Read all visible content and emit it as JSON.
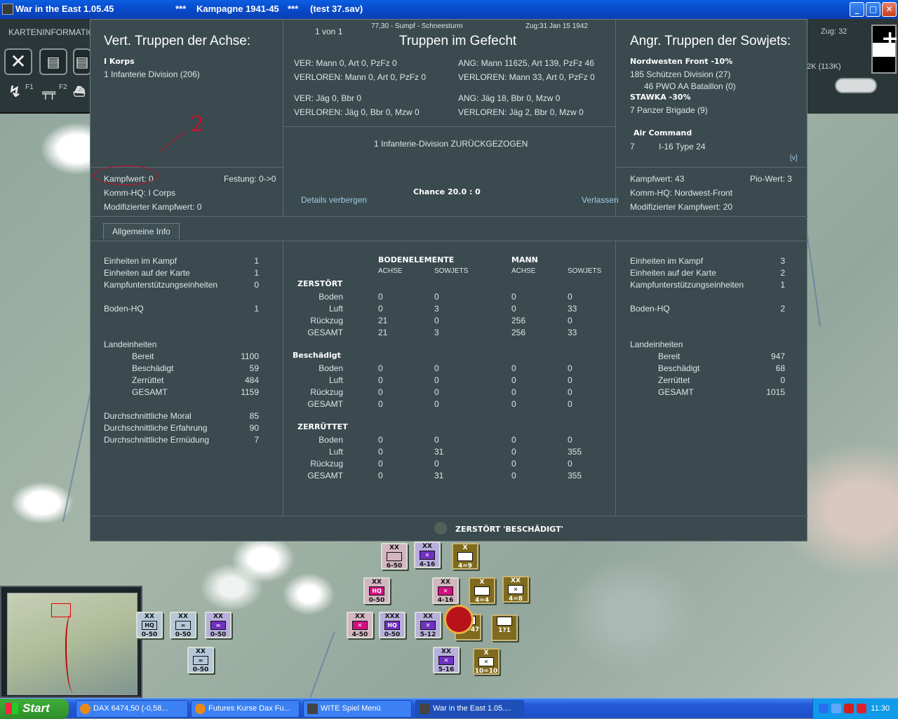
{
  "window": {
    "title_app": "War in the East 1.05.45",
    "title_stars1": "***",
    "title_campaign": "Kampagne 1941-45",
    "title_stars2": "***",
    "title_save": "(test 37.sav)",
    "btn_min": "_",
    "btn_max": "▢",
    "btn_close": "✕"
  },
  "control_panel": {
    "label": "KARTENINFORMATION",
    "f1": "F1",
    "f2": "F2"
  },
  "right_panel": {
    "turn": "Zug: 32",
    "k": "2K (113K)"
  },
  "dialog": {
    "left": {
      "title": "Vert. Truppen der Achse:",
      "corps": "I Korps",
      "division": "1 Infanterie Division (206)",
      "kampfwert": "Kampfwert: 0",
      "festung": "Festung: 0->0",
      "kommhq": "Komm-HQ: I Corps",
      "modkampfwert": "Modifizierter Kampfwert: 0"
    },
    "center": {
      "counter": "1 von 1",
      "info": "77,30 - Sumpf - Schneesturm",
      "turn_date": "Zug:31  Jan 15 1942",
      "title": "Truppen im Gefecht",
      "ver1": "VER: Mann 0, Art 0, PzFz 0",
      "verloren1": "VERLOREN: Mann 0, Art 0, PzFz 0",
      "ang1": "ANG: Mann 11625, Art 139, PzFz 46",
      "angverloren1": "VERLOREN: Mann 33, Art 0, PzFz 0",
      "ver2": "VER: Jäg 0, Bbr 0",
      "verloren2": "VERLOREN: Jäg 0, Bbr 0, Mzw 0",
      "ang2": "ANG: Jäg 18, Bbr 0, Mzw 0",
      "angverloren2": "VERLOREN: Jäg 2, Bbr 0, Mzw 0",
      "result": "1 Infanterie-Division ZURÜCKGEZOGEN",
      "chance": "Chance 20.0 : 0",
      "details": "Details verbergen",
      "leave": "Verlassen"
    },
    "right": {
      "title": "Angr. Truppen der Sowjets:",
      "front": "Nordwesten Front  -10%",
      "div": "185 Schützen Division (27)",
      "aa": "46 PWO AA Bataillon (0)",
      "stawka": "STAWKA  -30%",
      "brigade": "7 Panzer Brigade (9)",
      "air": "Air Command",
      "air_num": "7",
      "air_type": "I-16 Type 24",
      "v": "[v]",
      "kampfwert": "Kampfwert: 43",
      "pio": "Pio-Wert: 3",
      "kommhq": "Komm-HQ: Nordwest-Front",
      "modkampfwert": "Modifizierter Kampfwert: 20"
    },
    "tab": "Allgemeine Info",
    "stats_left": {
      "rows": [
        {
          "label": "Einheiten im Kampf",
          "value": "1"
        },
        {
          "label": "Einheiten auf der Karte",
          "value": "1"
        },
        {
          "label": "Kampfunterstützungseinheiten",
          "value": "0"
        },
        {
          "label": "Boden-HQ",
          "value": "1"
        },
        {
          "label": "Landeinheiten",
          "value": ""
        },
        {
          "label": "Bereit",
          "value": "1100"
        },
        {
          "label": "Beschädigt",
          "value": "59"
        },
        {
          "label": "Zerrüttet",
          "value": "484"
        },
        {
          "label": "GESAMT",
          "value": "1159"
        },
        {
          "label": "Durchschnittliche Moral",
          "value": "85"
        },
        {
          "label": "Durchschnittliche Erfahrung",
          "value": "90"
        },
        {
          "label": "Durchschnittliche Ermüdung",
          "value": "7"
        }
      ]
    },
    "stats_right": {
      "rows": [
        {
          "label": "Einheiten im Kampf",
          "value": "3"
        },
        {
          "label": "Einheiten auf der Karte",
          "value": "2"
        },
        {
          "label": "Kampfunterstützungseinheiten",
          "value": "1"
        },
        {
          "label": "Boden-HQ",
          "value": "2"
        },
        {
          "label": "Landeinheiten",
          "value": ""
        },
        {
          "label": "Bereit",
          "value": "947"
        },
        {
          "label": "Beschädigt",
          "value": "68"
        },
        {
          "label": "Zerrüttet",
          "value": "0"
        },
        {
          "label": "GESAMT",
          "value": "1015"
        }
      ]
    },
    "losses": {
      "h_ground": "BODENELEMENTE",
      "h_men": "MANN",
      "h_axis": "ACHSE",
      "h_sov": "SOWJETS",
      "sections": [
        {
          "title": "ZERSTÖRT",
          "rows": [
            [
              "Boden",
              "0",
              "0",
              "0",
              "0"
            ],
            [
              "Luft",
              "0",
              "3",
              "0",
              "33"
            ],
            [
              "Rückzug",
              "21",
              "0",
              "256",
              "0"
            ],
            [
              "GESAMT",
              "21",
              "3",
              "256",
              "33"
            ]
          ]
        },
        {
          "title": "Beschädigt",
          "rows": [
            [
              "Boden",
              "0",
              "0",
              "0",
              "0"
            ],
            [
              "Luft",
              "0",
              "0",
              "0",
              "0"
            ],
            [
              "Rückzug",
              "0",
              "0",
              "0",
              "0"
            ],
            [
              "GESAMT",
              "0",
              "0",
              "0",
              "0"
            ]
          ]
        },
        {
          "title": "ZERRÜTTET",
          "rows": [
            [
              "Boden",
              "0",
              "0",
              "0",
              "0"
            ],
            [
              "Luft",
              "0",
              "31",
              "0",
              "355"
            ],
            [
              "Rückzug",
              "0",
              "0",
              "0",
              "0"
            ],
            [
              "GESAMT",
              "0",
              "31",
              "0",
              "355"
            ]
          ]
        }
      ]
    },
    "footer": "ZERSTÖRT 'BESCHÄDIGT'"
  },
  "annotation": {
    "digit": "2"
  },
  "counters": [
    {
      "id": "c1",
      "top": "XX",
      "sym": "",
      "stat": "6-50"
    },
    {
      "id": "c2",
      "top": "XX",
      "sym": "✕",
      "stat": "4-16"
    },
    {
      "id": "c3",
      "top": "X",
      "sym": "",
      "stat": "4=9"
    },
    {
      "id": "c4",
      "top": "XX",
      "sym": "HQ",
      "stat": "0-50"
    },
    {
      "id": "c5",
      "top": "XX",
      "sym": "✕",
      "stat": "4-16"
    },
    {
      "id": "c6",
      "top": "X",
      "sym": "",
      "stat": "4=4"
    },
    {
      "id": "c7",
      "top": "XX",
      "sym": "✕",
      "stat": "4=8"
    },
    {
      "id": "c8",
      "top": "XX",
      "sym": "✕",
      "stat": "4-50"
    },
    {
      "id": "c9",
      "top": "XXX",
      "sym": "HQ",
      "stat": "0-50"
    },
    {
      "id": "c10",
      "top": "XX",
      "sym": "✕",
      "stat": "5-12"
    },
    {
      "id": "c11",
      "top": "",
      "sym": "",
      "stat": "14=47"
    },
    {
      "id": "c12",
      "top": "",
      "sym": "",
      "stat": "1?1"
    },
    {
      "id": "c13",
      "top": "XX",
      "sym": "HQ",
      "stat": "0-50"
    },
    {
      "id": "c14",
      "top": "XX",
      "sym": "∞",
      "stat": "0-50"
    },
    {
      "id": "c15",
      "top": "XX",
      "sym": "∞",
      "stat": "0-50"
    },
    {
      "id": "c16",
      "top": "XX",
      "sym": "∞",
      "stat": "0-50"
    },
    {
      "id": "c17",
      "top": "XX",
      "sym": "✕",
      "stat": "5-16"
    },
    {
      "id": "c18",
      "top": "X",
      "sym": "✕",
      "stat": "10=10"
    }
  ],
  "taskbar": {
    "start": "Start",
    "items": [
      "DAX 6474,50 (-0,58...",
      "Futures Kurse Dax Fu...",
      "WITE  Spiel Menü",
      "War in the East 1.05...."
    ],
    "clock": "11:30"
  }
}
